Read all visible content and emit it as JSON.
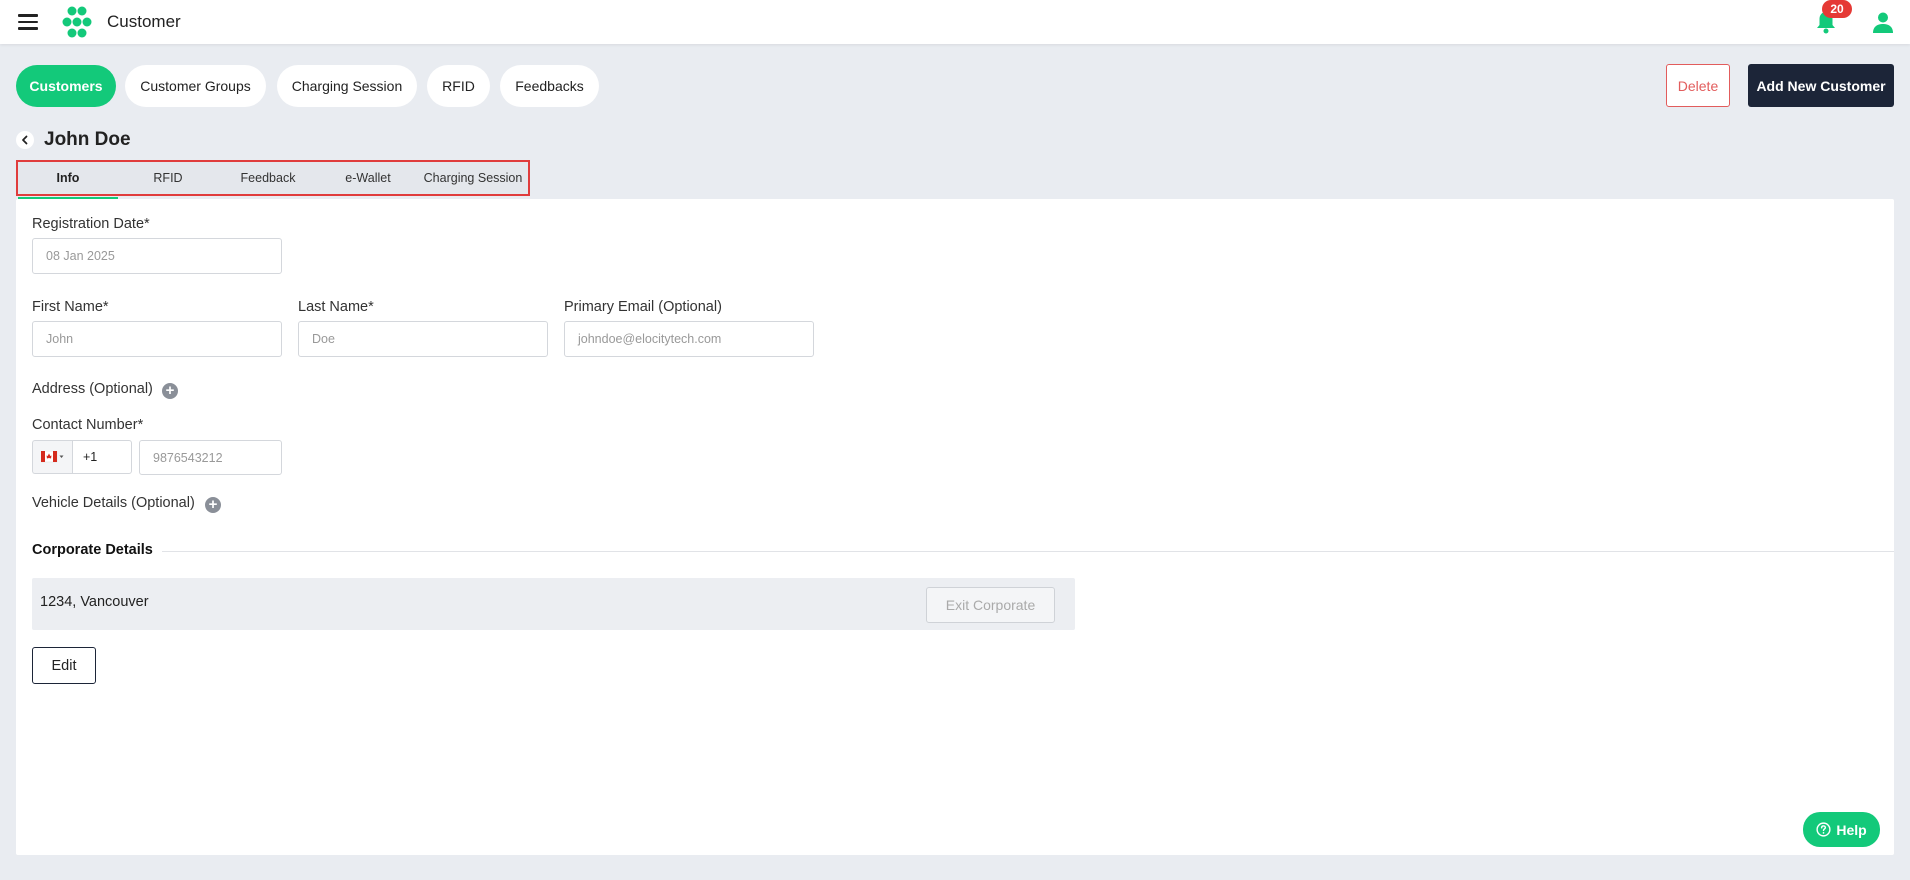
{
  "header": {
    "title": "Customer",
    "notification_count": "20"
  },
  "nav_tabs": [
    {
      "label": "Customers",
      "active": true
    },
    {
      "label": "Customer Groups",
      "active": false
    },
    {
      "label": "Charging Session",
      "active": false
    },
    {
      "label": "RFID",
      "active": false
    },
    {
      "label": "Feedbacks",
      "active": false
    }
  ],
  "actions": {
    "delete_label": "Delete",
    "add_label": "Add New Customer"
  },
  "page": {
    "title": "John Doe"
  },
  "sub_tabs": [
    {
      "label": "Info",
      "active": true
    },
    {
      "label": "RFID",
      "active": false
    },
    {
      "label": "Feedback",
      "active": false
    },
    {
      "label": "e-Wallet",
      "active": false
    },
    {
      "label": "Charging Session",
      "active": false
    }
  ],
  "form": {
    "registration_date_label": "Registration Date*",
    "registration_date_placeholder": "08 Jan 2025",
    "first_name_label": "First Name*",
    "first_name_placeholder": "John",
    "last_name_label": "Last Name*",
    "last_name_placeholder": "Doe",
    "email_label": "Primary Email (Optional)",
    "email_placeholder": "johndoe@elocitytech.com",
    "address_label": "Address (Optional)",
    "contact_label": "Contact Number*",
    "country_code": "+1",
    "phone_placeholder": "9876543212",
    "vehicle_label": "Vehicle Details (Optional)"
  },
  "corporate": {
    "section_title": "Corporate Details",
    "entry": "1234, Vancouver",
    "exit_label": "Exit Corporate"
  },
  "edit_label": "Edit",
  "help_label": "Help",
  "colors": {
    "accent": "#13c97a",
    "dark_button": "#1c2538",
    "danger": "#e25c5c",
    "highlight_border": "#e03c3c"
  }
}
